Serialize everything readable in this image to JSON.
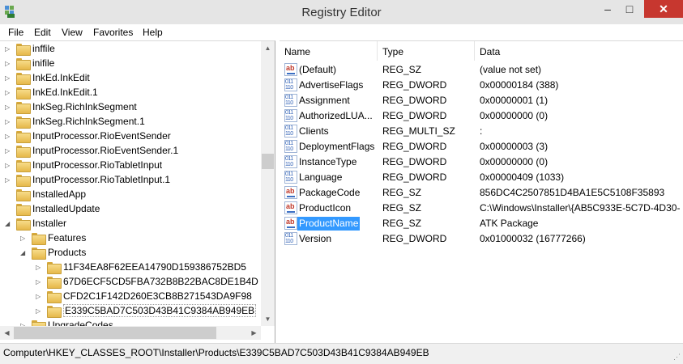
{
  "window": {
    "title": "Registry Editor",
    "minimize_glyph": "–",
    "maximize_glyph": "□",
    "close_glyph": "✕"
  },
  "menu": [
    "File",
    "Edit",
    "View",
    "Favorites",
    "Help"
  ],
  "tree": {
    "items": [
      {
        "label": "inffile",
        "depth": 1,
        "expander": "collapsed"
      },
      {
        "label": "inifile",
        "depth": 1,
        "expander": "collapsed"
      },
      {
        "label": "InkEd.InkEdit",
        "depth": 1,
        "expander": "collapsed"
      },
      {
        "label": "InkEd.InkEdit.1",
        "depth": 1,
        "expander": "collapsed"
      },
      {
        "label": "InkSeg.RichInkSegment",
        "depth": 1,
        "expander": "collapsed"
      },
      {
        "label": "InkSeg.RichInkSegment.1",
        "depth": 1,
        "expander": "collapsed"
      },
      {
        "label": "InputProcessor.RioEventSender",
        "depth": 1,
        "expander": "collapsed"
      },
      {
        "label": "InputProcessor.RioEventSender.1",
        "depth": 1,
        "expander": "collapsed"
      },
      {
        "label": "InputProcessor.RioTabletInput",
        "depth": 1,
        "expander": "collapsed"
      },
      {
        "label": "InputProcessor.RioTabletInput.1",
        "depth": 1,
        "expander": "collapsed"
      },
      {
        "label": "InstalledApp",
        "depth": 1,
        "expander": "none"
      },
      {
        "label": "InstalledUpdate",
        "depth": 1,
        "expander": "none"
      },
      {
        "label": "Installer",
        "depth": 1,
        "expander": "expanded"
      },
      {
        "label": "Features",
        "depth": 2,
        "expander": "collapsed"
      },
      {
        "label": "Products",
        "depth": 2,
        "expander": "expanded"
      },
      {
        "label": "11F34EA8F62EEA14790D159386752BD5",
        "depth": 3,
        "expander": "collapsed"
      },
      {
        "label": "67D6ECF5CD5FBA732B8B22BAC8DE1B4D",
        "depth": 3,
        "expander": "collapsed"
      },
      {
        "label": "CFD2C1F142D260E3CB8B271543DA9F98",
        "depth": 3,
        "expander": "collapsed"
      },
      {
        "label": "E339C5BAD7C503D43B41C9384AB949EB",
        "depth": 3,
        "expander": "collapsed",
        "selected": true
      },
      {
        "label": "UpgradeCodes",
        "depth": 2,
        "expander": "collapsed"
      }
    ]
  },
  "list": {
    "columns": {
      "name": "Name",
      "type": "Type",
      "data": "Data"
    },
    "rows": [
      {
        "icon": "string-value-icon",
        "kind": "sz",
        "name": "(Default)",
        "type": "REG_SZ",
        "data": "(value not set)"
      },
      {
        "icon": "binary-value-icon",
        "kind": "bin",
        "name": "AdvertiseFlags",
        "type": "REG_DWORD",
        "data": "0x00000184 (388)"
      },
      {
        "icon": "binary-value-icon",
        "kind": "bin",
        "name": "Assignment",
        "type": "REG_DWORD",
        "data": "0x00000001 (1)"
      },
      {
        "icon": "binary-value-icon",
        "kind": "bin",
        "name": "AuthorizedLUA...",
        "type": "REG_DWORD",
        "data": "0x00000000 (0)"
      },
      {
        "icon": "binary-value-icon",
        "kind": "bin",
        "name": "Clients",
        "type": "REG_MULTI_SZ",
        "data": ":"
      },
      {
        "icon": "binary-value-icon",
        "kind": "bin",
        "name": "DeploymentFlags",
        "type": "REG_DWORD",
        "data": "0x00000003 (3)"
      },
      {
        "icon": "binary-value-icon",
        "kind": "bin",
        "name": "InstanceType",
        "type": "REG_DWORD",
        "data": "0x00000000 (0)"
      },
      {
        "icon": "binary-value-icon",
        "kind": "bin",
        "name": "Language",
        "type": "REG_DWORD",
        "data": "0x00000409 (1033)"
      },
      {
        "icon": "string-value-icon",
        "kind": "sz",
        "name": "PackageCode",
        "type": "REG_SZ",
        "data": "856DC4C2507851D4BA1E5C5108F35893"
      },
      {
        "icon": "string-value-icon",
        "kind": "sz",
        "name": "ProductIcon",
        "type": "REG_SZ",
        "data": "C:\\Windows\\Installer\\{AB5C933E-5C7D-4D30-"
      },
      {
        "icon": "string-value-icon",
        "kind": "sz",
        "name": "ProductName",
        "type": "REG_SZ",
        "data": "ATK Package",
        "selected": true
      },
      {
        "icon": "binary-value-icon",
        "kind": "bin",
        "name": "Version",
        "type": "REG_DWORD",
        "data": "0x01000032 (16777266)"
      }
    ]
  },
  "status": {
    "path": "Computer\\HKEY_CLASSES_ROOT\\Installer\\Products\\E339C5BAD7C503D43B41C9384AB949EB"
  },
  "colors": {
    "selection": "#3399ff",
    "close_button": "#c7372f",
    "folder": "#f3d071"
  }
}
